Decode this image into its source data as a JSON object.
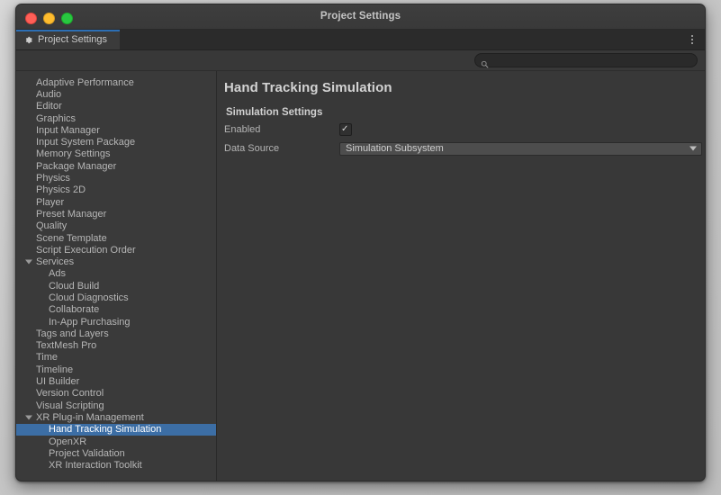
{
  "window": {
    "title": "Project Settings",
    "traffic_lights": [
      "close-button",
      "minimize-button",
      "maximize-button"
    ]
  },
  "tab": {
    "label": "Project Settings",
    "icon": "gear-icon",
    "accent_color": "#2c6fb5"
  },
  "toolbar": {
    "menu_icon": "kebab-menu-icon"
  },
  "search": {
    "value": "",
    "placeholder": "",
    "icon": "search-icon"
  },
  "sidebar": {
    "items": [
      {
        "label": "Adaptive Performance",
        "level": 0,
        "expandable": false,
        "selected": false
      },
      {
        "label": "Audio",
        "level": 0,
        "expandable": false,
        "selected": false
      },
      {
        "label": "Editor",
        "level": 0,
        "expandable": false,
        "selected": false
      },
      {
        "label": "Graphics",
        "level": 0,
        "expandable": false,
        "selected": false
      },
      {
        "label": "Input Manager",
        "level": 0,
        "expandable": false,
        "selected": false
      },
      {
        "label": "Input System Package",
        "level": 0,
        "expandable": false,
        "selected": false
      },
      {
        "label": "Memory Settings",
        "level": 0,
        "expandable": false,
        "selected": false
      },
      {
        "label": "Package Manager",
        "level": 0,
        "expandable": false,
        "selected": false
      },
      {
        "label": "Physics",
        "level": 0,
        "expandable": false,
        "selected": false
      },
      {
        "label": "Physics 2D",
        "level": 0,
        "expandable": false,
        "selected": false
      },
      {
        "label": "Player",
        "level": 0,
        "expandable": false,
        "selected": false
      },
      {
        "label": "Preset Manager",
        "level": 0,
        "expandable": false,
        "selected": false
      },
      {
        "label": "Quality",
        "level": 0,
        "expandable": false,
        "selected": false
      },
      {
        "label": "Scene Template",
        "level": 0,
        "expandable": false,
        "selected": false
      },
      {
        "label": "Script Execution Order",
        "level": 0,
        "expandable": false,
        "selected": false
      },
      {
        "label": "Services",
        "level": 0,
        "expandable": true,
        "selected": false
      },
      {
        "label": "Ads",
        "level": 1,
        "expandable": false,
        "selected": false
      },
      {
        "label": "Cloud Build",
        "level": 1,
        "expandable": false,
        "selected": false
      },
      {
        "label": "Cloud Diagnostics",
        "level": 1,
        "expandable": false,
        "selected": false
      },
      {
        "label": "Collaborate",
        "level": 1,
        "expandable": false,
        "selected": false
      },
      {
        "label": "In-App Purchasing",
        "level": 1,
        "expandable": false,
        "selected": false
      },
      {
        "label": "Tags and Layers",
        "level": 0,
        "expandable": false,
        "selected": false
      },
      {
        "label": "TextMesh Pro",
        "level": 0,
        "expandable": false,
        "selected": false
      },
      {
        "label": "Time",
        "level": 0,
        "expandable": false,
        "selected": false
      },
      {
        "label": "Timeline",
        "level": 0,
        "expandable": false,
        "selected": false
      },
      {
        "label": "UI Builder",
        "level": 0,
        "expandable": false,
        "selected": false
      },
      {
        "label": "Version Control",
        "level": 0,
        "expandable": false,
        "selected": false
      },
      {
        "label": "Visual Scripting",
        "level": 0,
        "expandable": false,
        "selected": false
      },
      {
        "label": "XR Plug-in Management",
        "level": 0,
        "expandable": true,
        "selected": false
      },
      {
        "label": "Hand Tracking Simulation",
        "level": 1,
        "expandable": false,
        "selected": true
      },
      {
        "label": "OpenXR",
        "level": 1,
        "expandable": false,
        "selected": false
      },
      {
        "label": "Project Validation",
        "level": 1,
        "expandable": false,
        "selected": false
      },
      {
        "label": "XR Interaction Toolkit",
        "level": 1,
        "expandable": false,
        "selected": false
      }
    ],
    "selection_color": "#3c6ea5"
  },
  "content": {
    "page_title": "Hand Tracking Simulation",
    "section_title": "Simulation Settings",
    "properties": {
      "enabled": {
        "label": "Enabled",
        "checked": true,
        "check_glyph": "✓"
      },
      "data_source": {
        "label": "Data Source",
        "value": "Simulation Subsystem"
      }
    }
  }
}
